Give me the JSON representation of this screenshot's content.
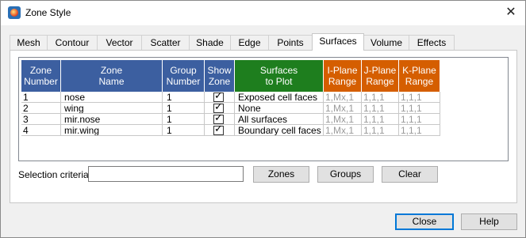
{
  "window": {
    "title": "Zone Style"
  },
  "tabs": [
    {
      "label": "Mesh"
    },
    {
      "label": "Contour"
    },
    {
      "label": "Vector"
    },
    {
      "label": "Scatter"
    },
    {
      "label": "Shade"
    },
    {
      "label": "Edge"
    },
    {
      "label": "Points"
    },
    {
      "label": "Surfaces"
    },
    {
      "label": "Volume"
    },
    {
      "label": "Effects"
    }
  ],
  "active_tab": "Surfaces",
  "table": {
    "headers": [
      "Zone\nNumber",
      "Zone\nName",
      "Group\nNumber",
      "Show\nZone",
      "Surfaces\nto Plot",
      "I-Plane\nRange",
      "J-Plane\nRange",
      "K-Plane\nRange"
    ],
    "header_colors": {
      "blue": "#3c5fa0",
      "green": "#1e7e1e",
      "orange": "#d55e00"
    },
    "rows": [
      {
        "num": "1",
        "name": "nose",
        "group": "1",
        "show": true,
        "surfaces": "Exposed cell faces",
        "i": "1,Mx,1",
        "j": "1,1,1",
        "k": "1,1,1"
      },
      {
        "num": "2",
        "name": "wing",
        "group": "1",
        "show": true,
        "surfaces": "None",
        "i": "1,Mx,1",
        "j": "1,1,1",
        "k": "1,1,1"
      },
      {
        "num": "3",
        "name": "mir.nose",
        "group": "1",
        "show": true,
        "surfaces": "All surfaces",
        "i": "1,Mx,1",
        "j": "1,1,1",
        "k": "1,1,1"
      },
      {
        "num": "4",
        "name": "mir.wing",
        "group": "1",
        "show": true,
        "surfaces": "Boundary cell faces",
        "i": "1,Mx,1",
        "j": "1,1,1",
        "k": "1,1,1"
      }
    ]
  },
  "selection": {
    "label": "Selection criteria:",
    "value": ""
  },
  "buttons": {
    "zones": "Zones",
    "groups": "Groups",
    "clear": "Clear",
    "close": "Close",
    "help": "Help"
  },
  "icons": {
    "app": "tecplot-app-icon",
    "close": "close-icon",
    "check": "checkmark-icon"
  }
}
